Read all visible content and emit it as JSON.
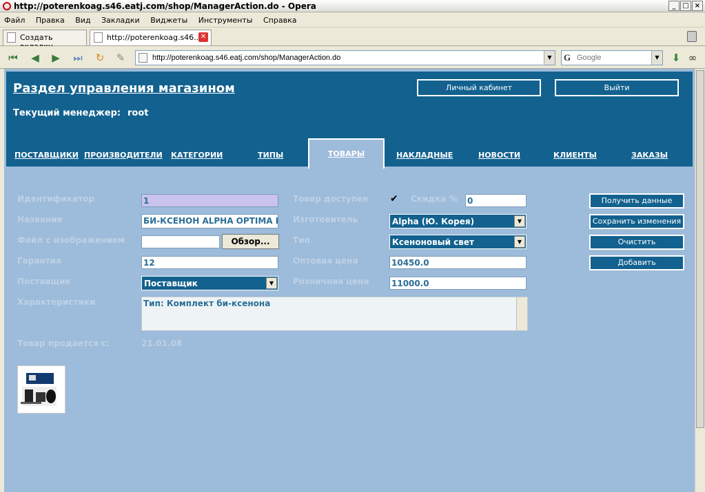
{
  "browser": {
    "title": "http://poterenkoag.s46.eatj.com/shop/ManagerAction.do - Opera",
    "menu": [
      "Файл",
      "Правка",
      "Вид",
      "Закладки",
      "Виджеты",
      "Инструменты",
      "Справка"
    ],
    "tabs": [
      {
        "label": "Создать вкладку"
      },
      {
        "label": "http://poterenkoag.s46...."
      }
    ],
    "address": "http://poterenkoag.s46.eatj.com/shop/ManagerAction.do",
    "search_placeholder": "Google",
    "window_controls": {
      "minimize": "_",
      "maximize": "□",
      "close": "×"
    }
  },
  "header": {
    "title": "Раздел управления магазином",
    "manager_label": "Текущий менеджер:",
    "manager_value": "root",
    "cabinet_button": "Личный кабинет",
    "logout_button": "Выйти"
  },
  "nav": {
    "items": [
      "ПОСТАВЩИКИ",
      "ПРОИЗВОДИТЕЛИ",
      "КАТЕГОРИИ",
      "ТИПЫ",
      "ТОВАРЫ",
      "НАКЛАДНЫЕ",
      "НОВОСТИ",
      "КЛИЕНТЫ",
      "ЗАКАЗЫ"
    ],
    "active": "ТОВАРЫ"
  },
  "form": {
    "id_label": "Идентификатор",
    "id_value": "1",
    "name_label": "Название",
    "name_value": "БИ-КСЕНОН ALPHA OPTIMA BI",
    "file_label": "Файл с изображением",
    "browse_button": "Обзор...",
    "warranty_label": "Гарантия",
    "warranty_value": "12",
    "supplier_label": "Поставщик",
    "supplier_value": "Поставщик",
    "specs_label": "Характеристики",
    "specs_value": "Тип: Комплект би-ксенона",
    "sale_since_label": "Товар продается с:",
    "sale_since_value": "21.01.08",
    "available_label": "Товар доступен",
    "available_checked": true,
    "discount_label": "Скидка %",
    "discount_value": "0",
    "maker_label": "Изготовитель",
    "maker_value": "Alpha (Ю. Корея)",
    "type_label": "Тип",
    "type_value": "Ксеноновый свет",
    "wholesale_label": "Оптовая цена",
    "wholesale_value": "10450.0",
    "retail_label": "Розничная цена",
    "retail_value": "11000.0"
  },
  "actions": {
    "get_data": "Получить данные",
    "save": "Сохранить изменения",
    "clear": "Очистить",
    "add": "Добавить"
  },
  "colors": {
    "header_bg": "#12618f",
    "page_bg": "#9dbbda",
    "label": "#bed1e6"
  }
}
